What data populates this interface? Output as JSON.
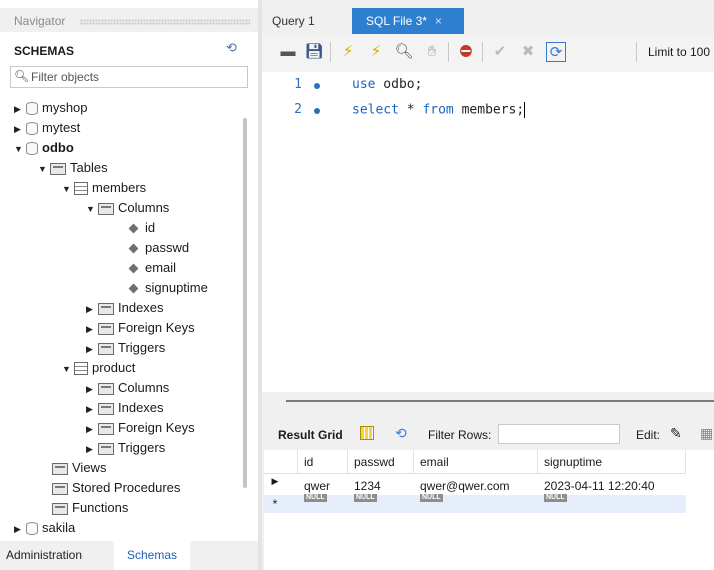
{
  "navigator": {
    "title": "Navigator",
    "schemas_label": "SCHEMAS",
    "filter_placeholder": "Filter objects",
    "tree": {
      "myshop": "myshop",
      "mytest": "mytest",
      "odbo": "odbo",
      "tables": "Tables",
      "members": "members",
      "columns1": "Columns",
      "col_id": "id",
      "col_passwd": "passwd",
      "col_email": "email",
      "col_signuptime": "signuptime",
      "indexes1": "Indexes",
      "foreign_keys1": "Foreign Keys",
      "triggers1": "Triggers",
      "product": "product",
      "columns2": "Columns",
      "indexes2": "Indexes",
      "foreign_keys2": "Foreign Keys",
      "triggers2": "Triggers",
      "views": "Views",
      "stored_procedures": "Stored Procedures",
      "functions": "Functions",
      "sakila": "sakila"
    },
    "bottom_tabs": {
      "administration": "Administration",
      "schemas": "Schemas"
    }
  },
  "tabs": {
    "query1": "Query 1",
    "sql_file": "SQL File 3*",
    "close": "×"
  },
  "toolbar": {
    "limit_label": "Limit to 100"
  },
  "editor": {
    "line1_num": "1",
    "line2_num": "2",
    "line1_kw": "use",
    "line1_rest": " odbo;",
    "line2_kw1": "select",
    "line2_mid": " * ",
    "line2_kw2": "from",
    "line2_rest": " members;"
  },
  "result": {
    "label": "Result Grid",
    "filter_label": "Filter Rows:",
    "edit_label": "Edit:",
    "columns": [
      "id",
      "passwd",
      "email",
      "signuptime"
    ],
    "row1": [
      "qwer",
      "1234",
      "qwer@qwer.com",
      "2023-04-11 12:20:40"
    ],
    "null_label": "NULL"
  },
  "colors": {
    "accent": "#2f7fd1",
    "keyword": "#1a64c8"
  }
}
